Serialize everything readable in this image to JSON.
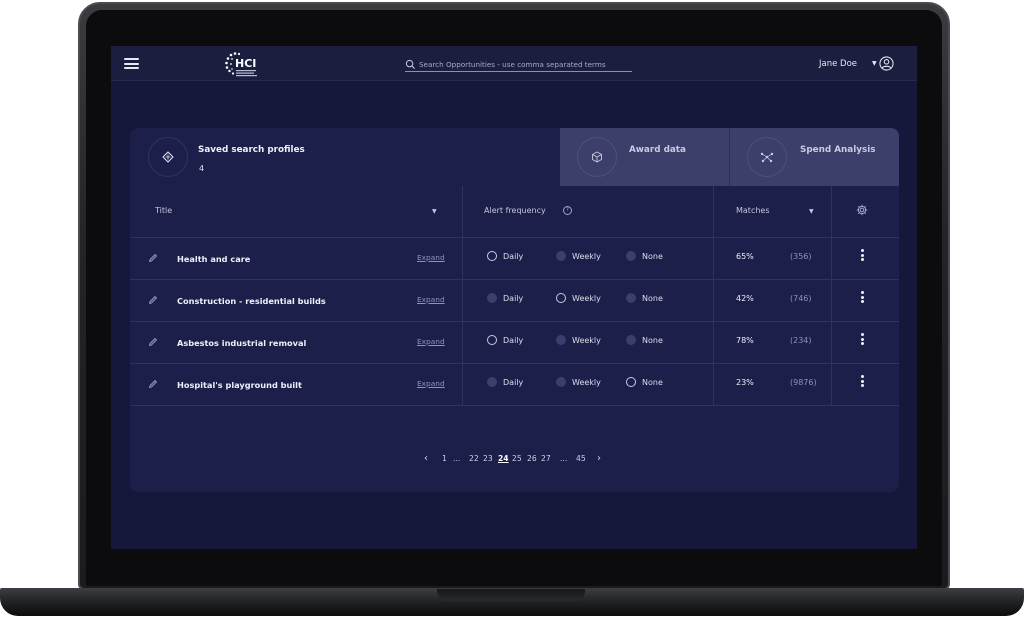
{
  "header": {
    "logo_text": "HCI",
    "search_placeholder": "Search Opportunities - use comma separated terms",
    "username": "Jane Doe"
  },
  "tabs": [
    {
      "title": "Saved search profiles",
      "count": "4"
    },
    {
      "title": "Award data"
    },
    {
      "title": "Spend Analysis"
    }
  ],
  "table": {
    "columns": {
      "title": "Title",
      "alert_frequency": "Alert frequency",
      "matches": "Matches"
    },
    "expand_label": "Expand",
    "frequency_options": [
      "Daily",
      "Weekly",
      "None"
    ],
    "rows": [
      {
        "title": "Health and care",
        "selected": "Daily",
        "match_pct": "65%",
        "match_count": "(356)"
      },
      {
        "title": "Construction - residential builds",
        "selected": "Weekly",
        "match_pct": "42%",
        "match_count": "(746)"
      },
      {
        "title": "Asbestos industrial removal",
        "selected": "Daily",
        "match_pct": "78%",
        "match_count": "(234)"
      },
      {
        "title": "Hospital's playground built",
        "selected": "None",
        "match_pct": "23%",
        "match_count": "(9876)"
      }
    ]
  },
  "pagination": {
    "items": [
      "1",
      "...",
      "22",
      "23",
      "24",
      "25",
      "26",
      "27",
      "...",
      "45"
    ],
    "current": "24"
  },
  "icons": {
    "menu": "hamburger-icon",
    "search": "search-icon",
    "user": "user-circle-icon",
    "saved": "diamond-icon",
    "award": "cube-icon",
    "spend": "network-icon",
    "edit": "pencil-icon",
    "settings": "gear-icon",
    "more": "kebab-icon"
  },
  "colors": {
    "screen_bg": "#15173b",
    "card_bg": "#1c1f49",
    "inactive_tab_bg": "#3b3f6a"
  }
}
